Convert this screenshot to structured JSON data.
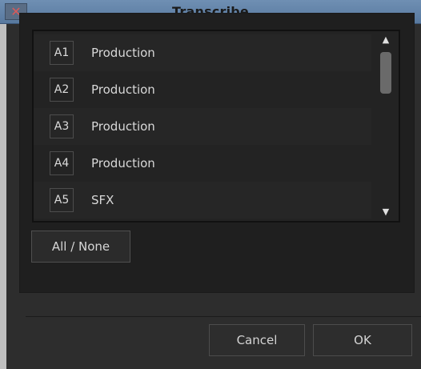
{
  "window": {
    "title": "Transcribe",
    "close_glyph": "✕"
  },
  "tracks": [
    {
      "id": "A1",
      "label": "Production"
    },
    {
      "id": "A2",
      "label": "Production"
    },
    {
      "id": "A3",
      "label": "Production"
    },
    {
      "id": "A4",
      "label": "Production"
    },
    {
      "id": "A5",
      "label": "SFX"
    }
  ],
  "scrollbar": {
    "up_glyph": "▲",
    "down_glyph": "▼"
  },
  "buttons": {
    "all_none": "All / None",
    "cancel": "Cancel",
    "ok": "OK"
  },
  "colors": {
    "titlebar": "#6384aa",
    "background": "#2c2c2c",
    "list_bg": "#232323"
  }
}
